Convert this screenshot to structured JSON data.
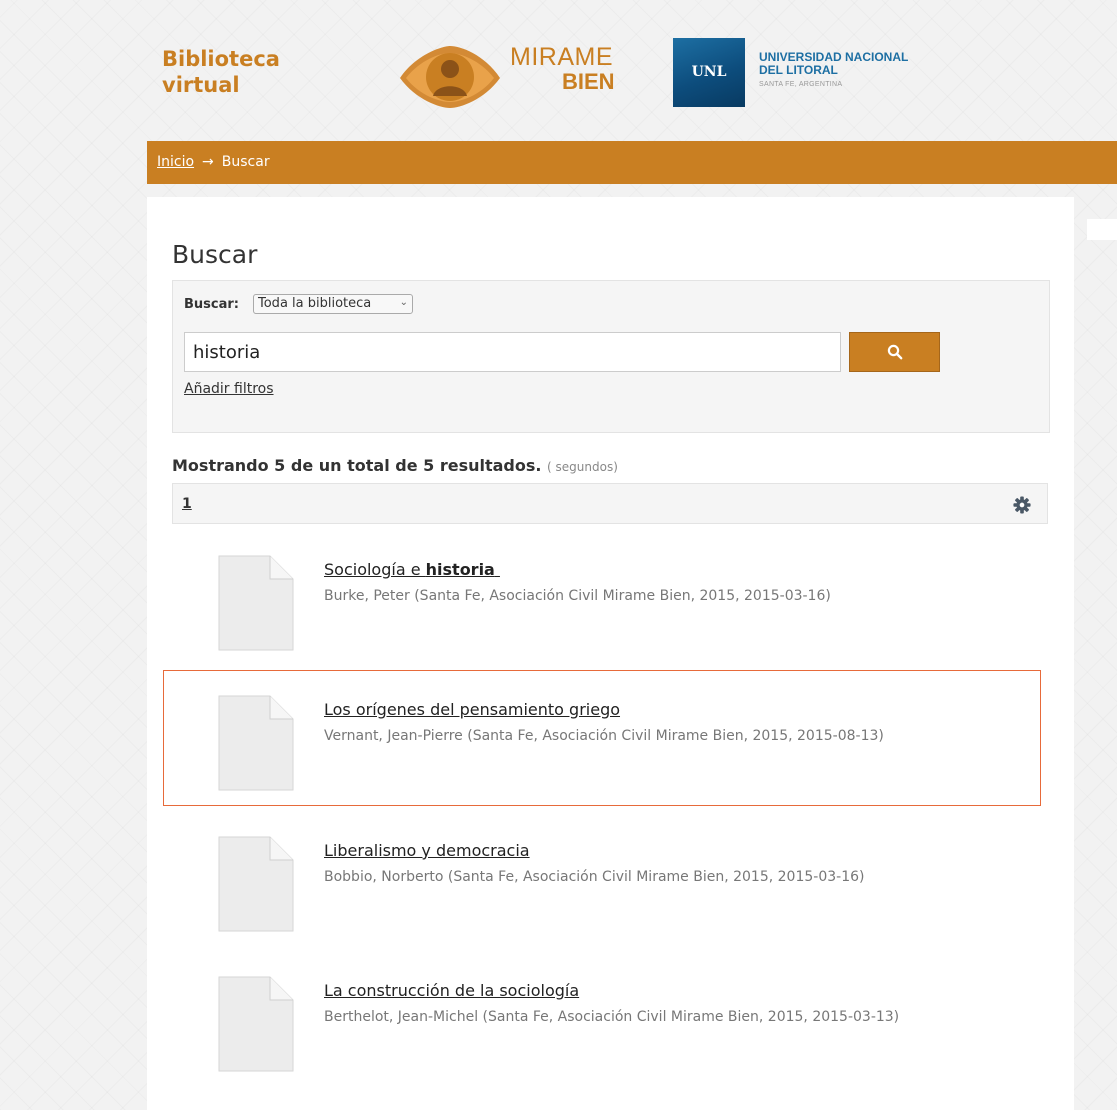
{
  "header": {
    "brand_line1": "Biblioteca",
    "brand_line2": "virtual",
    "mirame_word1": "MIRAME",
    "mirame_word2": "BIEN",
    "unl_abbr": "UNL",
    "unl_name1": "UNIVERSIDAD NACIONAL",
    "unl_name2": "DEL LITORAL",
    "unl_location": "SANTA FE, ARGENTINA",
    "accent_color": "#c97f22"
  },
  "breadcrumb": {
    "home": "Inicio",
    "separator": "→",
    "current": "Buscar"
  },
  "search": {
    "title": "Buscar",
    "scope_label": "Buscar:",
    "scope_selected": "Toda la biblioteca",
    "query": "historia",
    "button_icon": "search-icon",
    "filters_link": "Añadir filtros"
  },
  "results": {
    "summary_bold": "Mostrando 5 de un total de 5 resultados.",
    "summary_small": "( segundos)",
    "current_page": "1",
    "settings_icon": "gear-icon",
    "items": [
      {
        "title": "Sociología e ",
        "title_highlight": "historia",
        "meta": "Burke, Peter (Santa Fe, Asociación Civil Mirame Bien, 2015, 2015-03-16)"
      },
      {
        "title": "Los orígenes del pensamiento griego",
        "title_highlight": "",
        "meta": "Vernant, Jean-Pierre (Santa Fe, Asociación Civil Mirame Bien, 2015, 2015-08-13)"
      },
      {
        "title": "Liberalismo y democracia",
        "title_highlight": "",
        "meta": "Bobbio, Norberto (Santa Fe, Asociación Civil Mirame Bien, 2015, 2015-03-16)"
      },
      {
        "title": "La construcción de la sociología",
        "title_highlight": "",
        "meta": "Berthelot, Jean-Michel (Santa Fe, Asociación Civil Mirame Bien, 2015, 2015-03-13)"
      }
    ]
  }
}
